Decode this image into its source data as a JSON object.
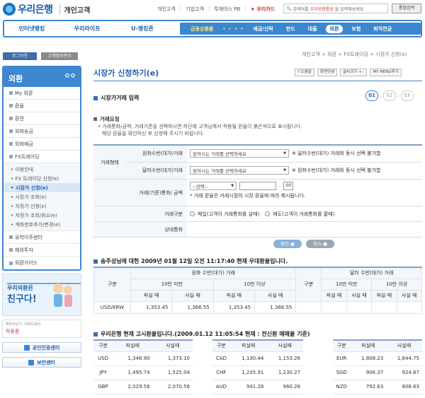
{
  "brand": {
    "name": "우리은행",
    "section": "개인고객"
  },
  "top_links": [
    "개인고객",
    "기업고객",
    "투체어스 PB",
    "우리카드"
  ],
  "search": {
    "prefix": "검색어를",
    "highlight": "우리닷컴통장",
    "suffix": "을 입력해보세요",
    "button": "통합검색"
  },
  "gnb": {
    "left": [
      "인터넷뱅킹",
      "우리라이프",
      "U-뱅킹존"
    ],
    "right_first": "금융상품몰",
    "right_dots": "• • • •",
    "right": [
      "예금/신탁",
      "펀드",
      "대출",
      "외환",
      "보험",
      "퇴직연금"
    ],
    "active": "외환"
  },
  "sidebar": {
    "login": "로그아웃",
    "info": "고객정보관리",
    "title": "외환",
    "title_icon": "⚙⚙",
    "items": [
      "My 외환",
      "환율",
      "환전",
      "외화송금",
      "외화예금",
      "FX트레이딩"
    ],
    "sub_items": [
      "이용안내",
      "FX 트레이딩 신청(e)",
      "시장가 신청(e)",
      "시장가 조회(e)",
      "지정가 신청(e)",
      "지정가 조회/취소(e)",
      "계좌번호추가/변경(e)"
    ],
    "active_sub": "시장가 신청(e)",
    "items_after": [
      "유학이주센터",
      "해외투자",
      "외환가이드"
    ],
    "banner_line1": "우리외환은",
    "banner_line2": "친구다!",
    "mini_text": "해킹차단기, 키보드보안",
    "mini_label": "작동중",
    "links": [
      "공인인증센터",
      "보안센터"
    ]
  },
  "breadcrumb": "개인고객 > 외환 > FX트레이딩 > 시장가 신청(e)",
  "page_title": "시장가 신청하기(e)",
  "tools": [
    "? 도움말",
    "화면인쇄",
    "글씨크기 + -",
    "MY MENU추가"
  ],
  "section1": "시장가거래 입력",
  "steps": [
    "01",
    "02",
    "03"
  ],
  "subsection": "거래요청",
  "notes": [
    "• 거래통화/금액, 거래기준을 선택하시면 하단에 고객님께서 적용될 환율이 붉은색으로 표시됩니다.",
    "  해당 환율을 확인하신 후 신청해 주시기 바랍니다."
  ],
  "form": {
    "type_label": "거래형태",
    "row1_label": "원화수반(대가)거래",
    "row1_select": "원하시는 거래를 선택하세요",
    "row1_note": "※ 달러수반(대가) 거래와 동시 선택 불가합",
    "row2_label": "달러수반(대가)거래",
    "row2_select": "원하시는 거래를 선택하세요",
    "row2_note": "※ 원화수반(대가) 거래와 동시 선택 불가합",
    "ccy_label": "거래(기준)통화/ 금액",
    "ccy_select": "--선택--",
    "ccy_decimal": "00",
    "ccy_note": "* 거래 환율은 거래시점의 시장 환율에 따라 제시됩니다.",
    "div_label": "거래구분",
    "div_opt1": "매입(고객이 거래통화를 살때)",
    "div_opt2": "매도(고객이 거래통화를 팔때)",
    "cpty_label": "상대통화"
  },
  "buttons": {
    "confirm": "확인 ●",
    "cancel": "취소 ●"
  },
  "pref_rate": {
    "title": "송주성님에 대한 2009년 01월 12일 오전 11:17:40 현재 우대환율입니다.",
    "gubun": "구분",
    "krw_head": "원화 수반(대가) 거래",
    "usd_head": "달러 수반(대가) 거래",
    "under": "10만 미만",
    "over": "10만 이상",
    "buy": "파실 때",
    "sell": "사실 때",
    "row": {
      "name": "USD/KRW",
      "values": [
        "1,353.45",
        "1,366.55",
        "1,353.45",
        "1,366.55",
        "",
        "",
        "",
        ""
      ]
    }
  },
  "notice_rate": {
    "title": "우리은행 현재 고시환율입니다.(2009.01.12 11:05:54 현재 : 전신환 매매율 기준)",
    "headers": [
      "구분",
      "파실때",
      "사실때"
    ],
    "groups": [
      [
        [
          "USD",
          "1,346.90",
          "1,373.10"
        ],
        [
          "JPY",
          "1,495.74",
          "1,525.04"
        ],
        [
          "GBP",
          "2,029.56",
          "2,070.56"
        ]
      ],
      [
        [
          "CAD",
          "1,130.44",
          "1,153.26"
        ],
        [
          "CHF",
          "1,205.91",
          "1,230.27"
        ],
        [
          "AUD",
          "941.28",
          "960.28"
        ]
      ],
      [
        [
          "EUR",
          "1,808.23",
          "1,844.75"
        ],
        [
          "SGD",
          "906.37",
          "924.67"
        ],
        [
          "NZD",
          "792.63",
          "808.63"
        ]
      ]
    ]
  }
}
